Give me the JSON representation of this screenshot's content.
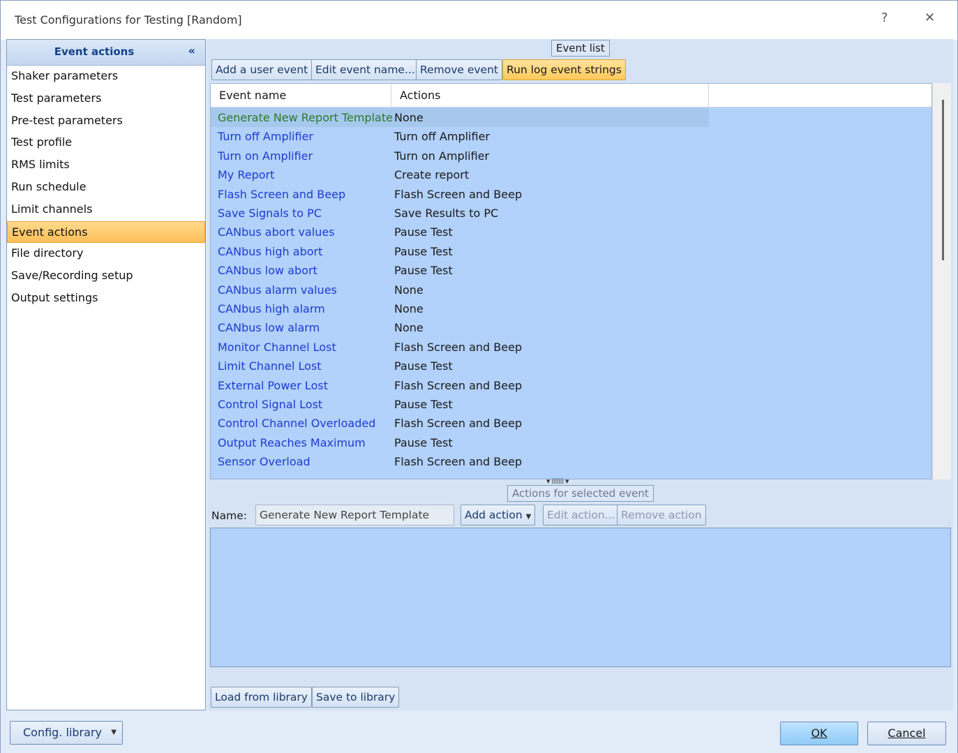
{
  "window": {
    "title": "Test Configurations for Testing [Random]",
    "help": "?",
    "close": "✕"
  },
  "sidebar": {
    "header": "Event actions",
    "collapse": "«",
    "items": [
      {
        "label": "Shaker parameters"
      },
      {
        "label": "Test parameters"
      },
      {
        "label": "Pre-test parameters"
      },
      {
        "label": "Test profile"
      },
      {
        "label": "RMS limits"
      },
      {
        "label": "Run schedule"
      },
      {
        "label": "Limit channels"
      },
      {
        "label": "Event actions",
        "selected": true
      },
      {
        "label": "File directory"
      },
      {
        "label": "Save/Recording setup"
      },
      {
        "label": "Output settings"
      }
    ]
  },
  "event_list": {
    "group_label": "Event list",
    "buttons": {
      "add": "Add a user event",
      "edit": "Edit event name...",
      "remove": "Remove event",
      "run_log": "Run log event strings"
    },
    "columns": {
      "name": "Event name",
      "actions": "Actions"
    },
    "rows": [
      {
        "name": "Generate New Report Template",
        "action": "None",
        "selected": true
      },
      {
        "name": "Turn off Amplifier",
        "action": "Turn off Amplifier"
      },
      {
        "name": "Turn on Amplifier",
        "action": "Turn on Amplifier"
      },
      {
        "name": "My Report",
        "action": "Create report"
      },
      {
        "name": "Flash Screen and Beep",
        "action": "Flash Screen and Beep"
      },
      {
        "name": "Save Signals to PC",
        "action": "Save Results to PC"
      },
      {
        "name": "CANbus abort values",
        "action": "Pause Test"
      },
      {
        "name": "CANbus high abort",
        "action": "Pause Test"
      },
      {
        "name": "CANbus low abort",
        "action": "Pause Test"
      },
      {
        "name": "CANbus alarm values",
        "action": "None"
      },
      {
        "name": "CANbus high alarm",
        "action": "None"
      },
      {
        "name": "CANbus low alarm",
        "action": "None"
      },
      {
        "name": "Monitor Channel Lost",
        "action": "Flash Screen and Beep"
      },
      {
        "name": "Limit Channel Lost",
        "action": "Pause Test"
      },
      {
        "name": "External Power Lost",
        "action": "Flash Screen and Beep"
      },
      {
        "name": "Control Signal Lost",
        "action": "Pause Test"
      },
      {
        "name": "Control Channel Overloaded",
        "action": "Flash Screen and Beep"
      },
      {
        "name": "Output Reaches Maximum",
        "action": "Pause Test"
      },
      {
        "name": "Sensor Overload",
        "action": "Flash Screen and Beep"
      }
    ]
  },
  "actions_panel": {
    "group_label": "Actions for selected event",
    "name_label": "Name:",
    "name_value": "Generate New Report Template",
    "add_action": "Add action",
    "edit_action": "Edit action...",
    "remove_action": "Remove action"
  },
  "library": {
    "load": "Load from library",
    "save": "Save to library"
  },
  "footer": {
    "config_library": "Config. library",
    "ok": "OK",
    "cancel": "Cancel"
  }
}
